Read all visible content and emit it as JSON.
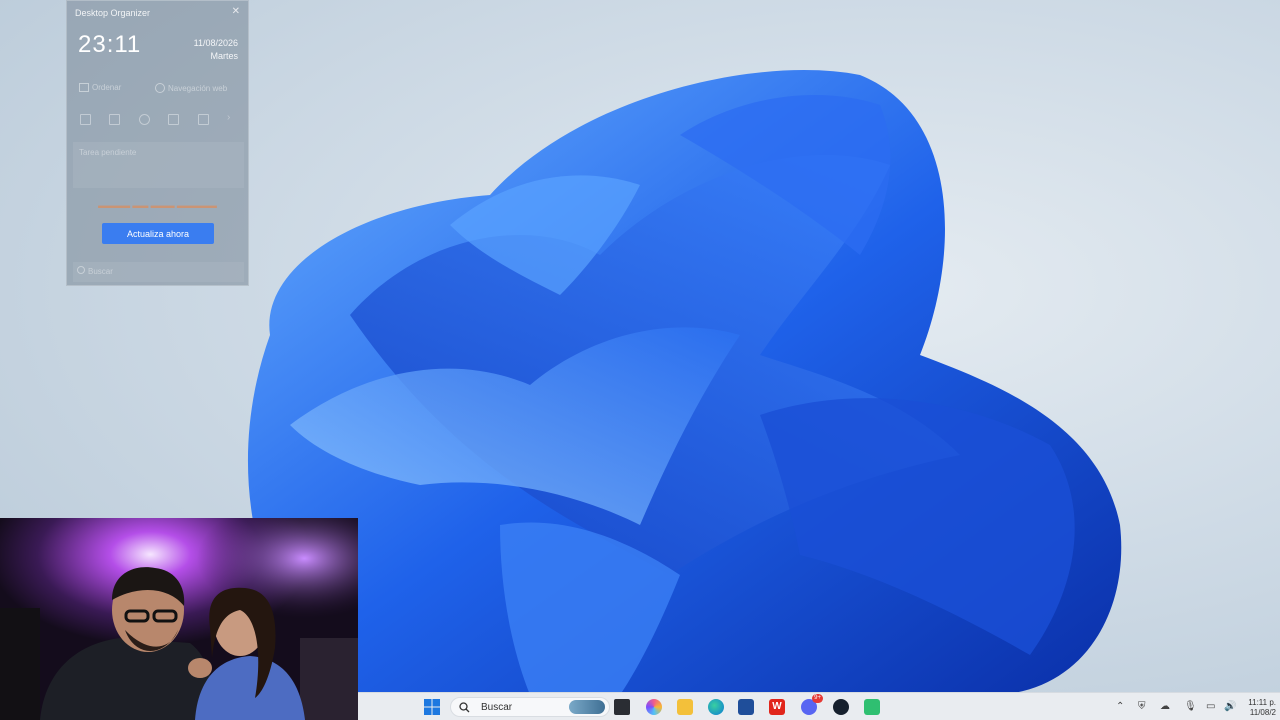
{
  "organizer": {
    "title": "Desktop Organizer",
    "time": "23:11",
    "date": "11/08/2026",
    "weekday": "Martes",
    "nav": {
      "order": "Ordenar",
      "web_nav": "Navegación web"
    },
    "task_placeholder": "Tarea pendiente",
    "upgrade_button": "Actualiza ahora",
    "search_placeholder": "Buscar"
  },
  "taskbar": {
    "search_placeholder": "Buscar",
    "clock_time": "11:11 p.",
    "clock_date": "11/08/2",
    "discord_badge": "9+"
  },
  "colors": {
    "accent": "#3a7df0",
    "bloom": "#1e5fe6",
    "taskbar": "#e9ecf0"
  }
}
